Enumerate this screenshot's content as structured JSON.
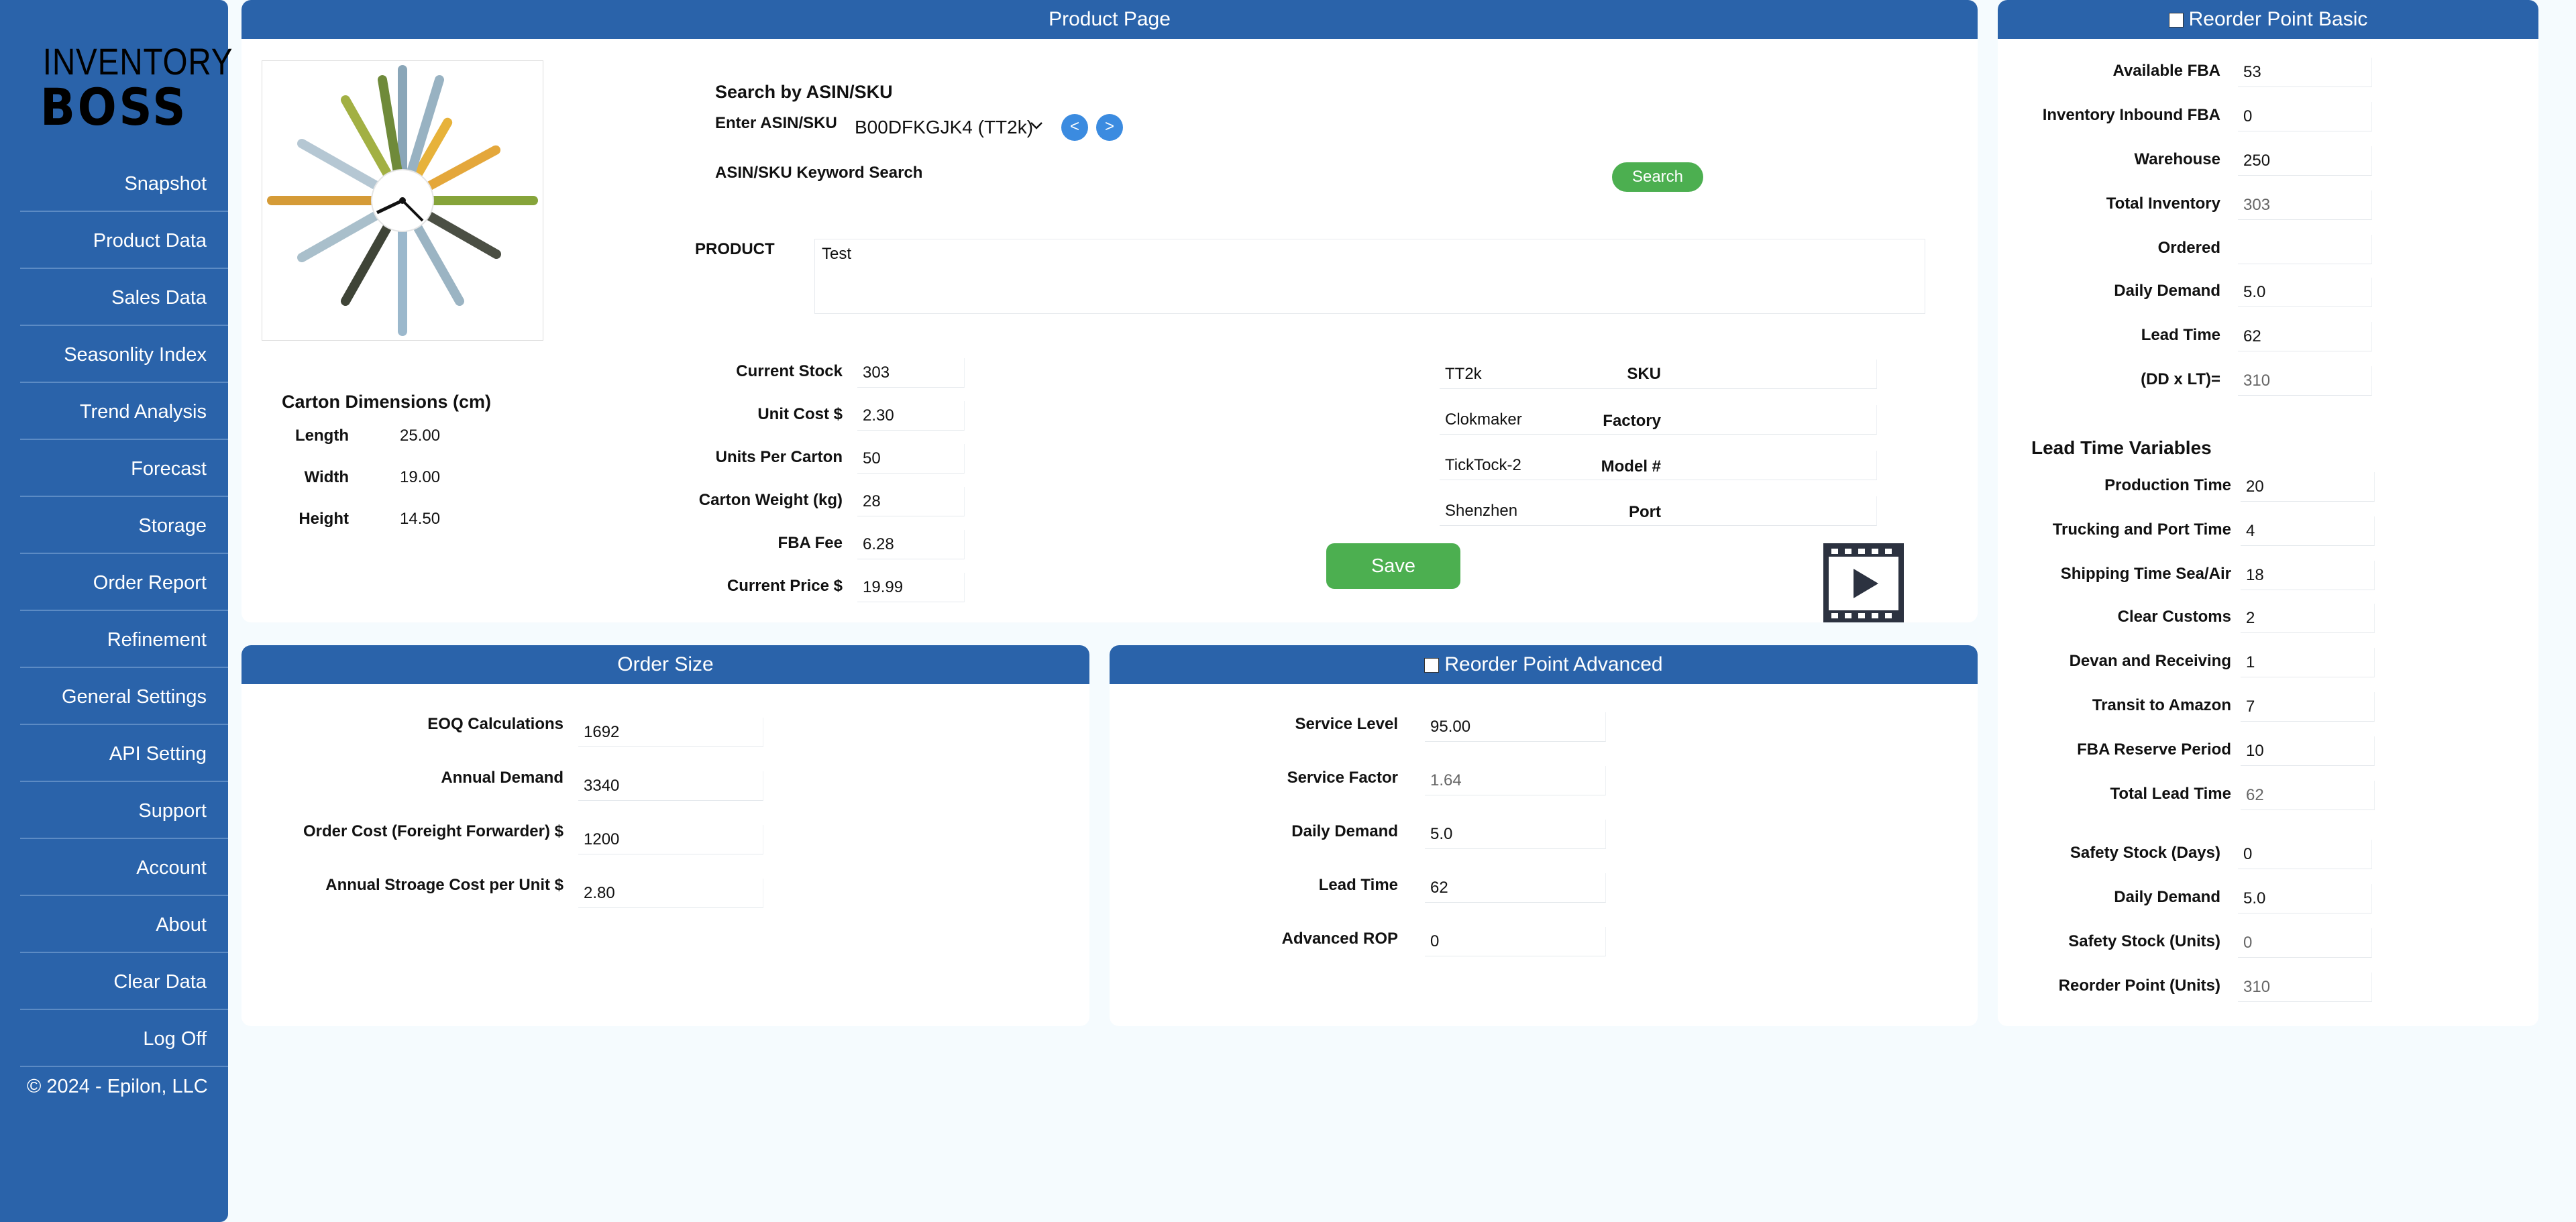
{
  "logo": {
    "line1": "INVENTORY",
    "line2": "BOSS"
  },
  "sidebar": {
    "items": [
      {
        "label": "Snapshot"
      },
      {
        "label": "Product Data"
      },
      {
        "label": "Sales Data"
      },
      {
        "label": "Seasonlity Index"
      },
      {
        "label": "Trend Analysis"
      },
      {
        "label": "Forecast"
      },
      {
        "label": "Storage"
      },
      {
        "label": "Order Report"
      },
      {
        "label": "Refinement"
      },
      {
        "label": "General Settings"
      },
      {
        "label": "API Setting"
      },
      {
        "label": "Support"
      },
      {
        "label": "Account"
      },
      {
        "label": "About"
      },
      {
        "label": "Clear Data"
      },
      {
        "label": "Log Off"
      }
    ],
    "copyright": "© 2024 - Epilon, LLC"
  },
  "product_page": {
    "title": "Product Page",
    "search_heading": "Search by ASIN/SKU",
    "asin_label": "Enter ASIN/SKU",
    "asin_value": "B00DFKGJK4 (TT2k)",
    "prev": "<",
    "next": ">",
    "keyword_label": "ASIN/SKU Keyword Search",
    "search_button": "Search",
    "product_label": "PRODUCT",
    "product_value": "Test",
    "carton": {
      "heading": "Carton Dimensions (cm)",
      "length_label": "Length",
      "length": "25.00",
      "width_label": "Width",
      "width": "19.00",
      "height_label": "Height",
      "height": "14.50"
    },
    "stock": {
      "current_stock_label": "Current Stock",
      "current_stock": "303",
      "unit_cost_label": "Unit Cost $",
      "unit_cost": "2.30",
      "units_per_carton_label": "Units Per Carton",
      "units_per_carton": "50",
      "carton_weight_label": "Carton Weight (kg)",
      "carton_weight": "28",
      "fba_fee_label": "FBA Fee",
      "fba_fee": "6.28",
      "current_price_label": "Current Price $",
      "current_price": "19.99"
    },
    "details": {
      "sku_label": "SKU",
      "sku": "TT2k",
      "factory_label": "Factory",
      "factory": "Clokmaker",
      "model_label": "Model #",
      "model": "TickTock-2",
      "port_label": "Port",
      "port": "Shenzhen"
    },
    "save_button": "Save"
  },
  "order_size": {
    "title": "Order Size",
    "eoq_label": "EOQ Calculations",
    "eoq": "1692",
    "annual_demand_label": "Annual Demand",
    "annual_demand": "3340",
    "order_cost_label": "Order Cost (Foreight Forwarder) $",
    "order_cost": "1200",
    "storage_cost_label": "Annual Stroage Cost per Unit $",
    "storage_cost": "2.80"
  },
  "rop_advanced": {
    "title": "Reorder Point Advanced",
    "service_level_label": "Service Level",
    "service_level": "95.00",
    "service_factor_label": "Service Factor",
    "service_factor": "1.64",
    "daily_demand_label": "Daily Demand",
    "daily_demand": "5.0",
    "lead_time_label": "Lead Time",
    "lead_time": "62",
    "advanced_rop_label": "Advanced ROP",
    "advanced_rop": "0"
  },
  "rop_basic": {
    "title": "Reorder Point Basic",
    "available_fba_label": "Available FBA",
    "available_fba": "53",
    "inbound_fba_label": "Inventory Inbound FBA",
    "inbound_fba": "0",
    "warehouse_label": "Warehouse",
    "warehouse": "250",
    "total_inventory_label": "Total Inventory",
    "total_inventory": "303",
    "ordered_label": "Ordered",
    "ordered": "",
    "daily_demand_label": "Daily Demand",
    "daily_demand": "5.0",
    "lead_time_label": "Lead Time",
    "lead_time": "62",
    "ddlt_label": "(DD x LT)=",
    "ddlt": "310",
    "ltv_heading": "Lead Time Variables",
    "production_time_label": "Production Time",
    "production_time": "20",
    "trucking_label": "Trucking and Port Time",
    "trucking": "4",
    "shipping_label": "Shipping Time Sea/Air",
    "shipping": "18",
    "customs_label": "Clear Customs",
    "customs": "2",
    "devan_label": "Devan and Receiving",
    "devan": "1",
    "transit_label": "Transit to Amazon",
    "transit": "7",
    "reserve_label": "FBA Reserve Period",
    "reserve": "10",
    "total_lead_label": "Total Lead Time",
    "total_lead": "62",
    "ss_days_label": "Safety Stock (Days)",
    "ss_days": "0",
    "daily_demand2_label": "Daily Demand",
    "daily_demand2": "5.0",
    "ss_units_label": "Safety Stock (Units)",
    "ss_units": "0",
    "rop_units_label": "Reorder Point (Units)",
    "rop_units": "310"
  },
  "colors": {
    "brand_blue": "#2a63aa",
    "green": "#4caf50",
    "nav_blue": "#3b8be0"
  }
}
